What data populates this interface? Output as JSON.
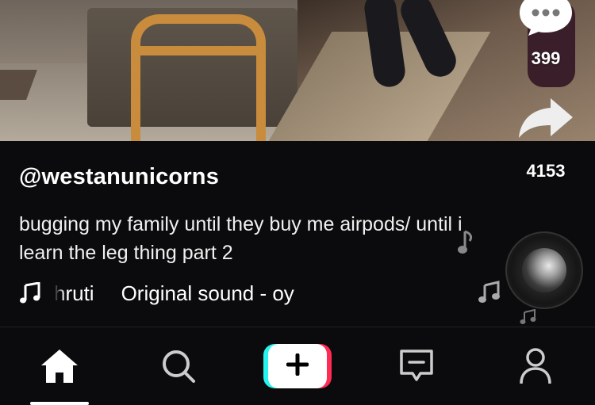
{
  "actions": {
    "comments_count": "399",
    "shares_count": "4153"
  },
  "post": {
    "username": "@westanunicorns",
    "caption": "bugging my family until they buy me airpods/ until i learn the leg thing part 2",
    "sound_author": "hruti",
    "sound_title": "Original sound - oy"
  },
  "icons": {
    "comment": "comment-bubble-icon",
    "share": "share-arrow-icon",
    "music": "music-note-icon",
    "disc": "spinning-record-disc",
    "home": "home-icon",
    "discover": "search-icon",
    "create": "plus-icon",
    "inbox": "inbox-message-icon",
    "profile": "person-icon"
  },
  "colors": {
    "background": "#0b0b0d",
    "create_cyan": "#25f4ee",
    "create_red": "#fe2c55",
    "text": "#ffffff"
  }
}
